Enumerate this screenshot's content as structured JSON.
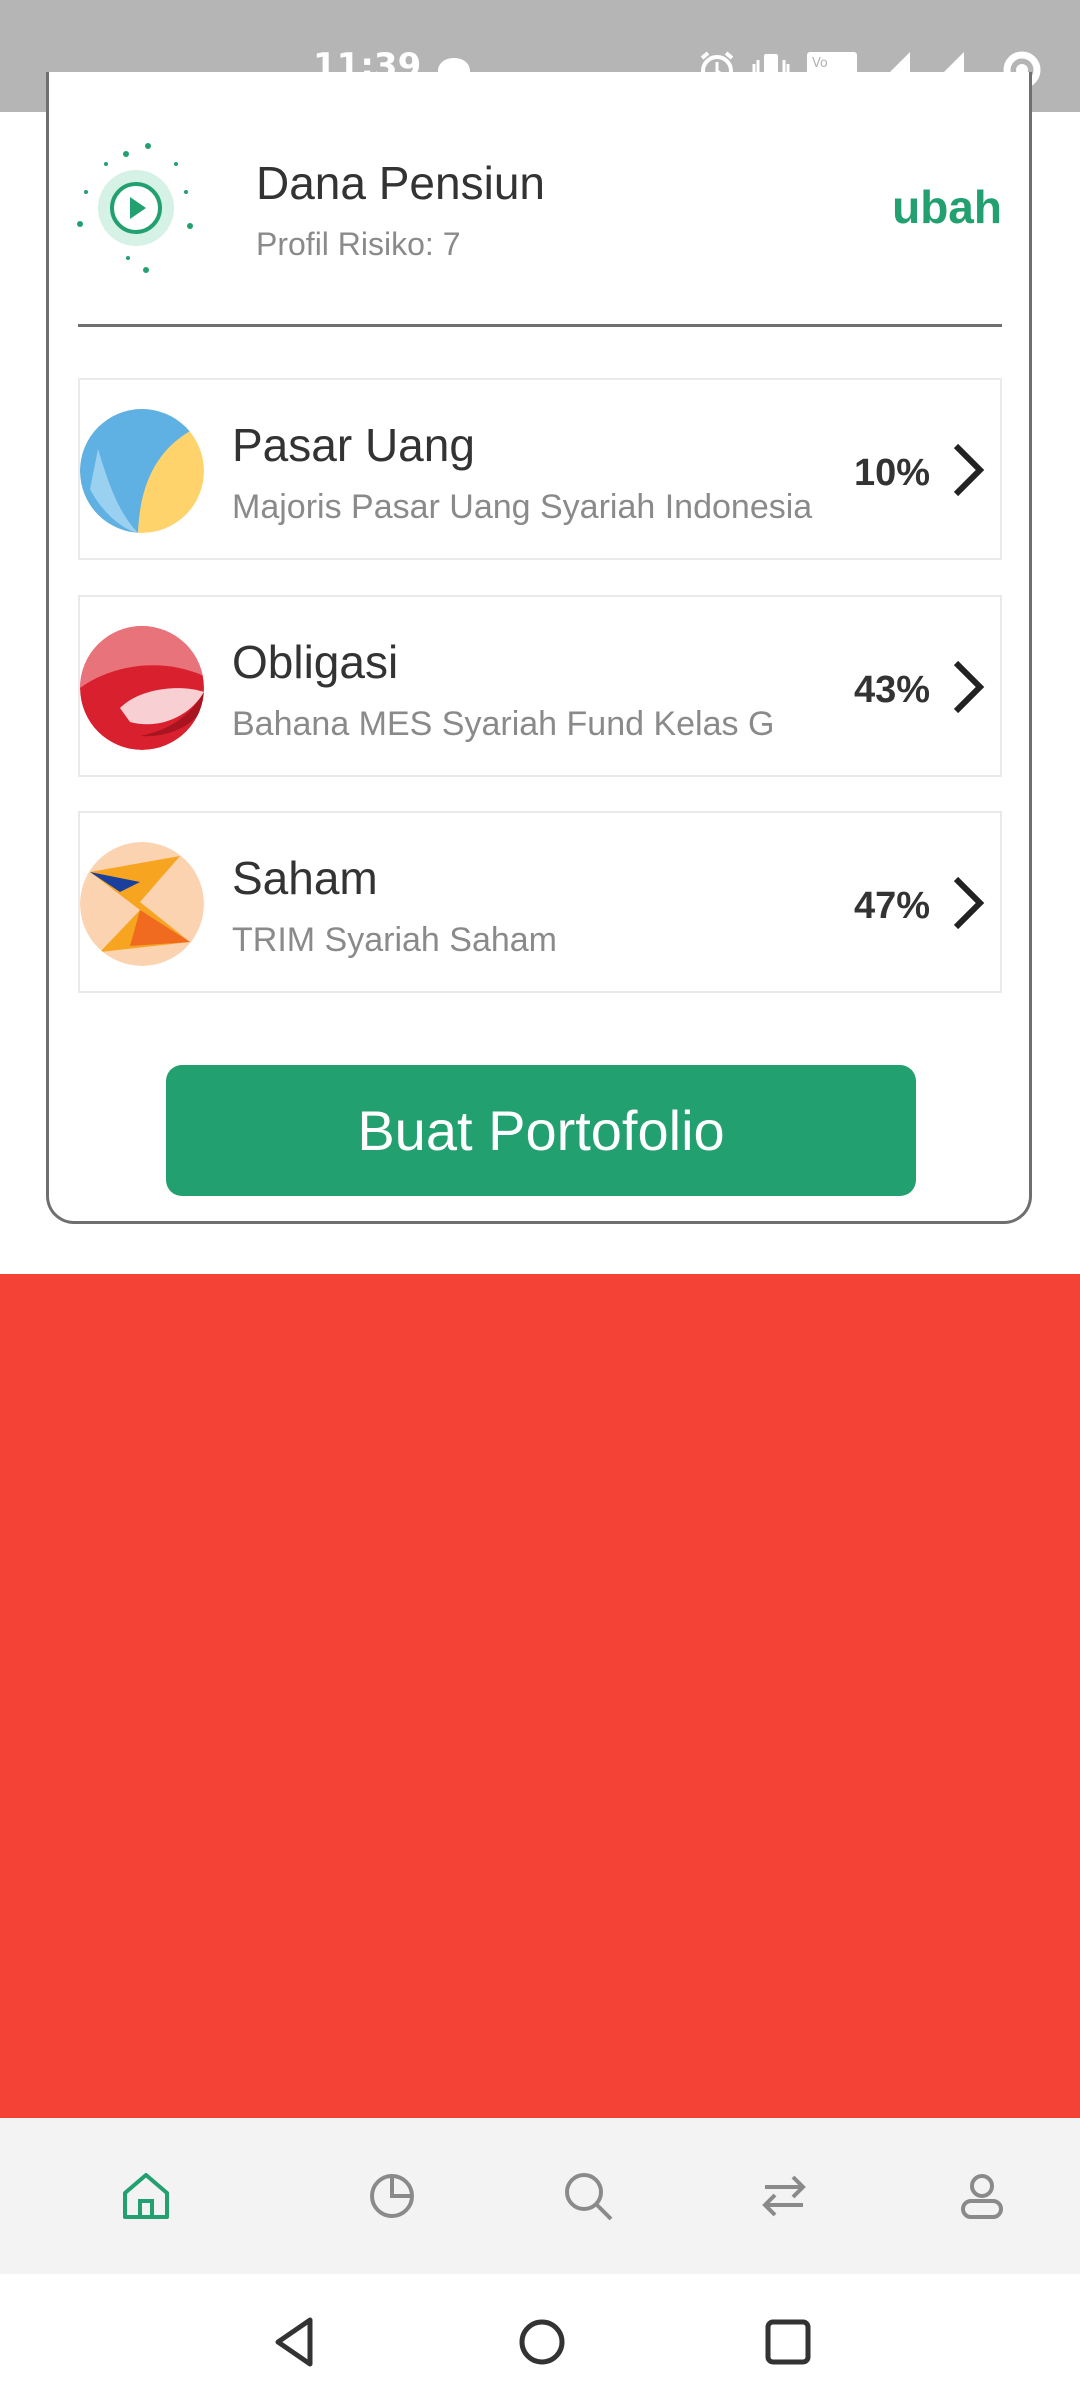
{
  "status_bar": {
    "time": "11:39",
    "icons": [
      "chat-bubble-icon",
      "alarm-icon",
      "vibrate-icon",
      "volte-icon",
      "signal-icon",
      "signal-icon",
      "battery-ring-icon"
    ]
  },
  "goal": {
    "title": "Dana Pensiun",
    "risk_profile": "Profil Risiko: 7",
    "edit_label": "ubah"
  },
  "funds": [
    {
      "category": "Pasar Uang",
      "product": "Majoris Pasar Uang Syariah Indonesia",
      "percent": "10%"
    },
    {
      "category": "Obligasi",
      "product": "Bahana MES Syariah Fund Kelas G",
      "percent": "43%"
    },
    {
      "category": "Saham",
      "product": "TRIM Syariah Saham",
      "percent": "47%"
    }
  ],
  "cta": {
    "label": "Buat Portofolio"
  },
  "bottom_nav": [
    "home-icon",
    "portfolio-pie-icon",
    "search-icon",
    "transfer-icon",
    "profile-icon"
  ],
  "colors": {
    "accent": "#22a06f",
    "banner": "#f44336",
    "status_bar": "#b5b5b5"
  }
}
